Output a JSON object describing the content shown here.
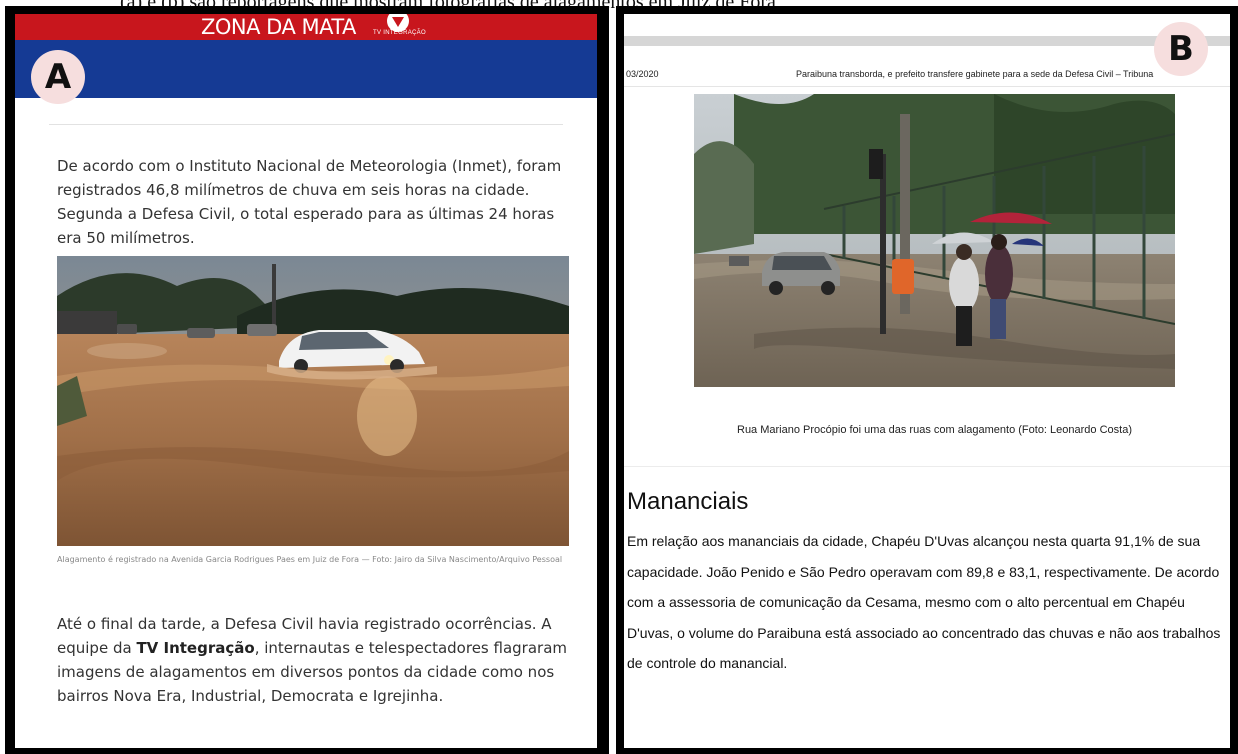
{
  "top_caption": "(a) e (b) são reportagens que mostram fotografias de alagamentos em Juiz de Fora",
  "panel_a": {
    "badge": "A",
    "brand": "ZONA DA MATA",
    "logo_text": "TV INTEGRAÇÃO",
    "paragraph_1": "De acordo com o Instituto Nacional de Meteorologia (Inmet), foram registrados 46,8 milímetros de chuva em seis horas na cidade. Segunda a Defesa Civil, o total esperado para as últimas 24 horas era 50 milímetros.",
    "photo_caption": "Alagamento é registrado na Avenida Garcia Rodrigues Paes em Juiz de Fora — Foto: Jairo da Silva Nascimento/Arquivo Pessoal",
    "paragraph_2_before": "Até o final da tarde, a Defesa Civil havia registrado ocorrências. A equipe da ",
    "paragraph_2_bold": "TV Integração",
    "paragraph_2_after": ", internautas e telespectadores flagraram imagens de alagamentos em diversos pontos da cidade como nos bairros Nova Era, Industrial, Democrata e Igrejinha."
  },
  "panel_b": {
    "badge": "B",
    "date": "03/2020",
    "article_title": "Paraibuna transborda, e prefeito transfere gabinete para a sede da Defesa Civil – Tribuna",
    "photo_caption": "Rua Mariano Procópio foi uma das ruas com alagamento (Foto: Leonardo Costa)",
    "heading": "Mananciais",
    "body": "Em relação aos mananciais da cidade, Chapéu D'Uvas alcançou nesta quarta 91,1% de sua capacidade. João Penido e São Pedro operavam com 89,8 e 83,1, respectivamente. De acordo com a assessoria de comunicação da Cesama, mesmo com o alto percentual em Chapéu D'uvas, o volume do Paraibuna está associado ao concentrado das chuvas e não aos trabalhos de controle do manancial."
  },
  "colors": {
    "header_red": "#c8161d",
    "header_blue": "#153a94",
    "badge_bg": "#f6dede"
  }
}
